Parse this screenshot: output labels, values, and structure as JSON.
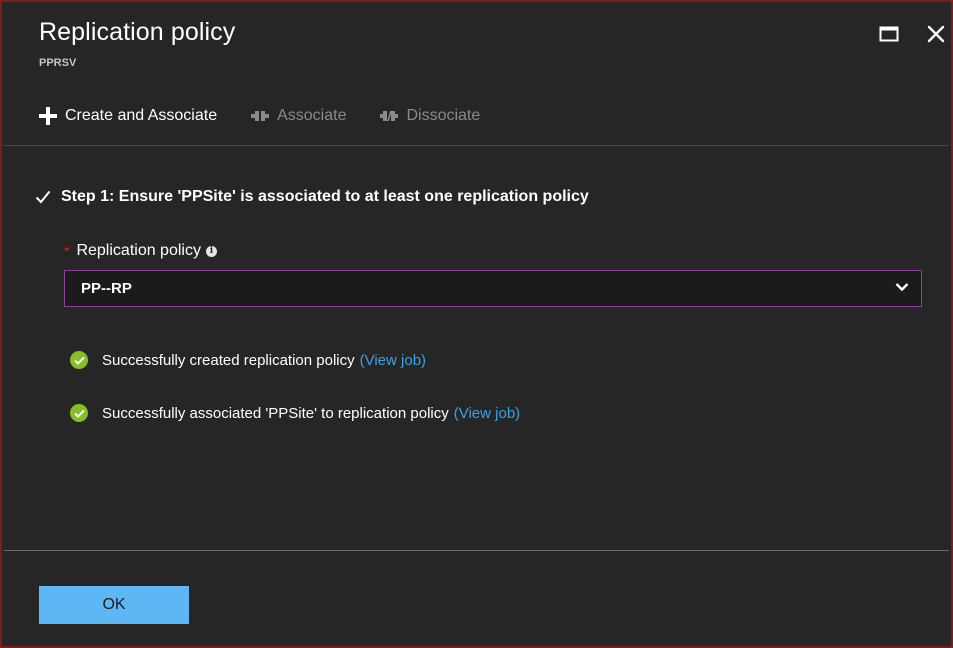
{
  "header": {
    "title": "Replication policy",
    "subtitle": "PPRSV"
  },
  "toolbar": {
    "create_label": "Create and Associate",
    "associate_label": "Associate",
    "dissociate_label": "Dissociate"
  },
  "step": {
    "text": "Step 1: Ensure 'PPSite' is associated to at least one replication policy"
  },
  "policy_field": {
    "required_marker": "*",
    "label": "Replication policy",
    "info_glyph": "i",
    "selected_value": "PP--RP"
  },
  "messages": [
    {
      "text": "Successfully created replication policy",
      "link": "(View job)"
    },
    {
      "text": "Successfully associated 'PPSite' to replication policy",
      "link": "(View job)"
    }
  ],
  "footer": {
    "ok_label": "OK"
  },
  "icons": {
    "maximize": "maximize-icon",
    "close": "close-icon",
    "plus": "plus-icon",
    "associate": "associate-icon",
    "dissociate": "dissociate-icon",
    "check": "checkmark-icon",
    "success": "success-check-icon",
    "chevron": "chevron-down-icon",
    "info": "info-icon"
  },
  "colors": {
    "background": "#262626",
    "accent_border": "#8e3fa3",
    "link": "#36a3e6",
    "success": "#84bf25",
    "primary_button": "#5db7f5",
    "required": "#e02020",
    "window_border": "#7a1f1f"
  }
}
